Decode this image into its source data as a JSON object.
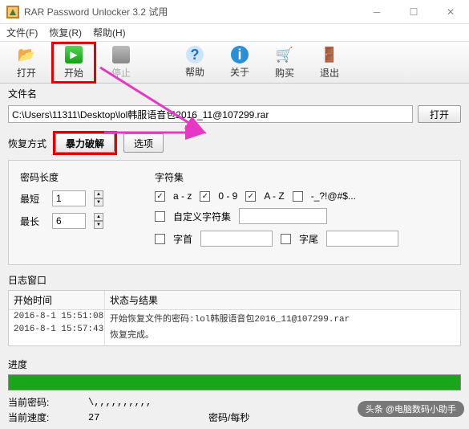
{
  "window": {
    "title": "RAR Password Unlocker 3.2 试用"
  },
  "menu": {
    "file": "文件(F)",
    "recover": "恢复(R)",
    "help": "帮助(H)"
  },
  "toolbar": {
    "open": "打开",
    "start": "开始",
    "stop": "停止",
    "helpBtn": "帮助",
    "about": "关于",
    "buy": "购买",
    "exit": "退出"
  },
  "file": {
    "label": "文件名",
    "path": "C:\\Users\\11311\\Desktop\\lol韩服语音包2016_11@107299.rar",
    "openBtn": "打开"
  },
  "recovery": {
    "label": "恢复方式",
    "tabBrute": "暴力破解",
    "tabOptions": "选项"
  },
  "password": {
    "lengthLabel": "密码长度",
    "minLabel": "最短",
    "minVal": "1",
    "maxLabel": "最长",
    "maxVal": "6",
    "charsetLabel": "字符集",
    "az": "a - z",
    "n09": "0 - 9",
    "AZ": "A - Z",
    "special": "-_?!@#$...",
    "custom": "自定义字符集",
    "prefix": "字首",
    "suffix": "字尾"
  },
  "log": {
    "label": "日志窗口",
    "timeHeader": "开始时间",
    "statusHeader": "状态与结果",
    "rows": [
      {
        "t": "2016-8-1 15:51:08",
        "s": "开始恢复文件的密码:lol韩服语音包2016_11@107299.rar"
      },
      {
        "t": "2016-8-1 15:57:43",
        "s": "恢复完成。"
      }
    ]
  },
  "progress": {
    "label": "进度"
  },
  "status": {
    "curPwdLabel": "当前密码:",
    "curPwd": "\\,,,,,,,,,,",
    "curSpeedLabel": "当前速度:",
    "curSpeed": "27",
    "unit": "密码/每秒"
  },
  "watermark": "头条 @电脑数码小助手"
}
